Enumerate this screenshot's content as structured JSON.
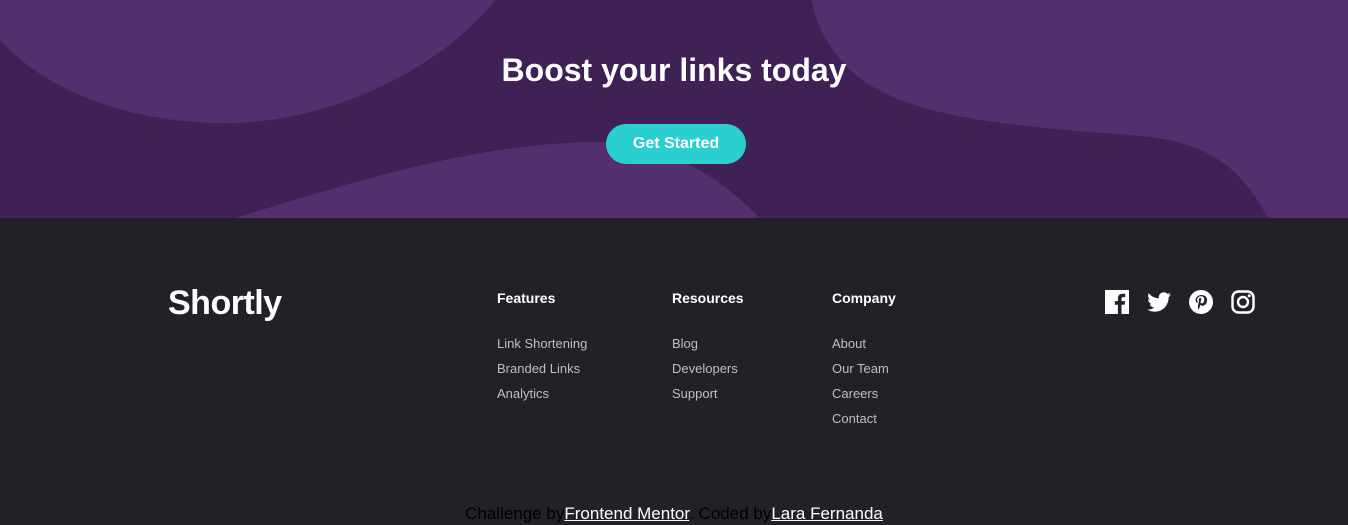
{
  "boost": {
    "title": "Boost your links today",
    "cta_label": "Get Started"
  },
  "footer": {
    "logo": "Shortly",
    "columns": [
      {
        "heading": "Features",
        "links": [
          "Link Shortening",
          "Branded Links",
          "Analytics"
        ]
      },
      {
        "heading": "Resources",
        "links": [
          "Blog",
          "Developers",
          "Support"
        ]
      },
      {
        "heading": "Company",
        "links": [
          "About",
          "Our Team",
          "Careers",
          "Contact"
        ]
      }
    ],
    "social": [
      "facebook-icon",
      "twitter-icon",
      "pinterest-icon",
      "instagram-icon"
    ]
  },
  "attribution": {
    "challenge_prefix": "Challenge by",
    "challenge_link": "Frontend Mentor",
    "coded_prefix": ". Coded by",
    "coded_link": "Lara Fernanda"
  },
  "colors": {
    "boost_bg": "#3f2155",
    "boost_shapes": "#4b2a69",
    "cyan": "#2acfcf",
    "footer_bg": "#232127",
    "footer_link": "#bfbfbf"
  }
}
